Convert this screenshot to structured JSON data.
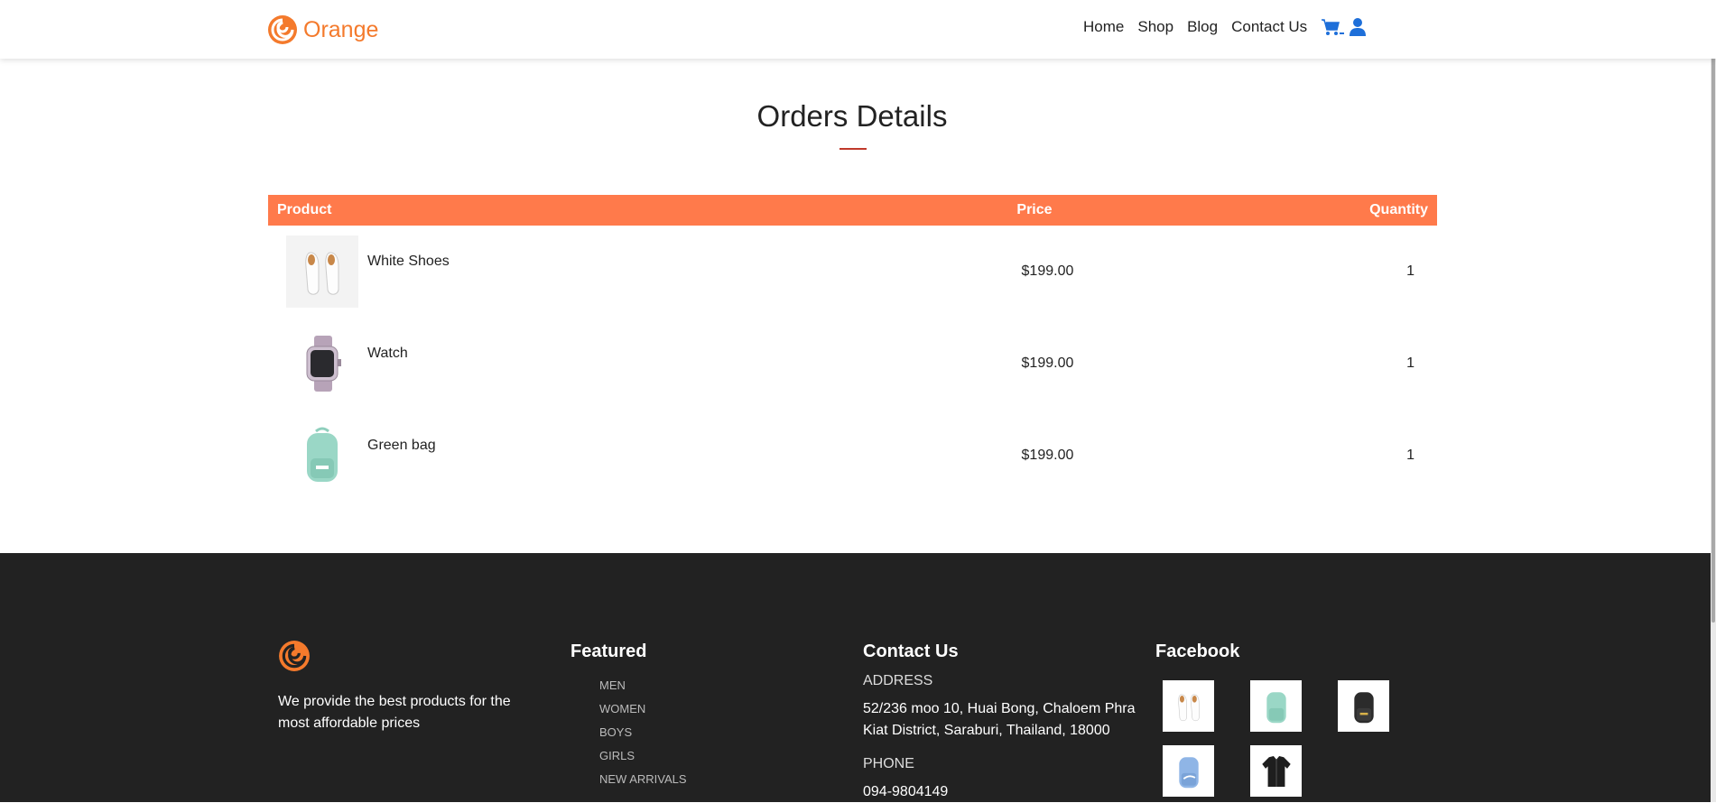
{
  "navbar": {
    "brand": "Orange",
    "links": [
      "Home",
      "Shop",
      "Blog",
      "Contact Us"
    ],
    "cart_icon": "cart-icon",
    "user_icon": "user-icon"
  },
  "page": {
    "title": "Orders Details"
  },
  "table": {
    "headers": {
      "product": "Product",
      "price": "Price",
      "quantity": "Quantity"
    },
    "rows": [
      {
        "name": "White Shoes",
        "price": "$199.00",
        "qty": "1",
        "image": "white-shoes-image"
      },
      {
        "name": "Watch",
        "price": "$199.00",
        "qty": "1",
        "image": "watch-image"
      },
      {
        "name": "Green bag",
        "price": "$199.00",
        "qty": "1",
        "image": "green-bag-image"
      }
    ]
  },
  "footer": {
    "about": "We provide the best products for the most affordable prices",
    "featured": {
      "heading": "Featured",
      "items": [
        "MEN",
        "WOMEN",
        "BOYS",
        "GIRLS",
        "NEW ARRIVALS"
      ]
    },
    "contact": {
      "heading": "Contact Us",
      "address_label": "ADDRESS",
      "address": "52/236 moo 10, Huai Bong, Chaloem Phra Kiat District, Saraburi, Thailand, 18000",
      "phone_label": "PHONE",
      "phone": "094-9804149"
    },
    "facebook": {
      "heading": "Facebook",
      "images": [
        "white-shoes-image",
        "green-bag-image",
        "black-bag-image",
        "blue-bag-image",
        "black-jacket-image"
      ]
    }
  },
  "colors": {
    "brand": "#f47a2c",
    "table_header": "#ff7a4b",
    "footer_bg": "#222222",
    "nav_icon": "#1e6fd9"
  }
}
